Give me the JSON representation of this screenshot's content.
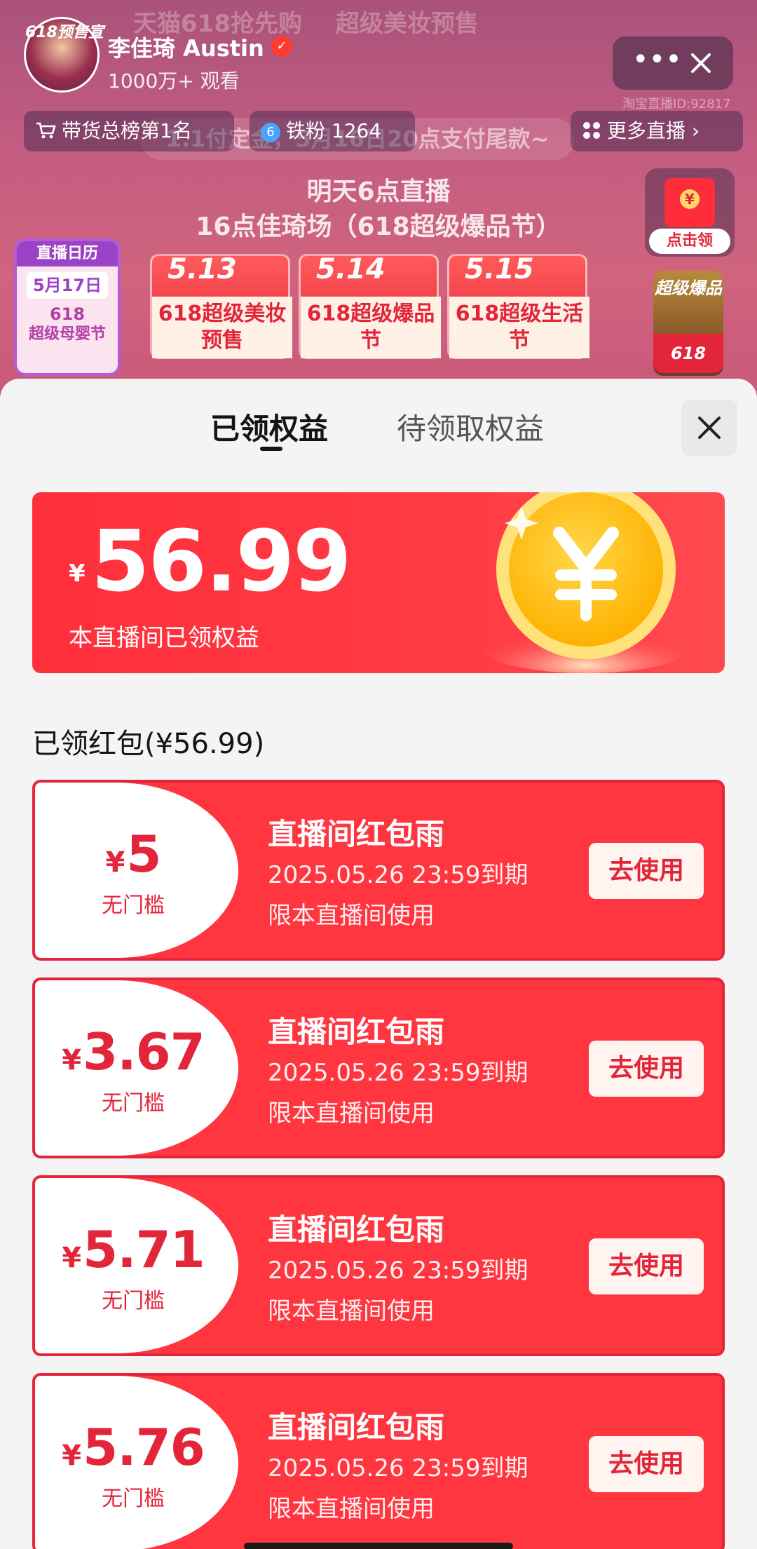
{
  "live": {
    "banner_items": [
      "天猫618抢先购",
      "超级美妆预售"
    ],
    "hero_text": "1.1付定金，5月16日20点支付尾款~",
    "schedule_line1": "明天6点直播",
    "schedule_line2": "16点佳琦场（618超级爆品节）",
    "date_cards": [
      {
        "date": "5.13",
        "title": "618超级美妆预售"
      },
      {
        "date": "5.14",
        "title": "618超级爆品节"
      },
      {
        "date": "5.15",
        "title": "618超级生活节"
      }
    ],
    "calendar": {
      "head": "直播日历",
      "date": "5月17日",
      "line1": "618",
      "line2": "超级母婴节"
    },
    "avatar_tag": "618预售宣",
    "streamer_name": "李佳琦 Austin",
    "viewers": "1000万+ 观看",
    "live_id": "淘宝直播ID:92817",
    "chips": {
      "rank": "带货总榜第1名",
      "fans_level": "6",
      "fans": "铁粉 1264",
      "more": "更多直播"
    },
    "redpack_button": "点击领",
    "promo_text": "超级爆品",
    "promo_618": "618"
  },
  "sheet": {
    "tabs": [
      {
        "label": "已领权益",
        "active": true
      },
      {
        "label": "待领取权益",
        "active": false
      }
    ],
    "summary": {
      "currency": "¥",
      "amount": "56.99",
      "label": "本直播间已领权益"
    },
    "list_title": "已领红包(¥56.99)",
    "coupons": [
      {
        "currency": "¥",
        "value": "5",
        "condition": "无门槛",
        "title": "直播间红包雨",
        "expiry": "2025.05.26 23:59到期",
        "scope": "限本直播间使用",
        "button": "去使用"
      },
      {
        "currency": "¥",
        "value": "3.67",
        "condition": "无门槛",
        "title": "直播间红包雨",
        "expiry": "2025.05.26 23:59到期",
        "scope": "限本直播间使用",
        "button": "去使用"
      },
      {
        "currency": "¥",
        "value": "5.71",
        "condition": "无门槛",
        "title": "直播间红包雨",
        "expiry": "2025.05.26 23:59到期",
        "scope": "限本直播间使用",
        "button": "去使用"
      },
      {
        "currency": "¥",
        "value": "5.76",
        "condition": "无门槛",
        "title": "直播间红包雨",
        "expiry": "2025.05.26 23:59到期",
        "scope": "限本直播间使用",
        "button": "去使用"
      }
    ]
  },
  "colors": {
    "accent_red": "#e3253a",
    "sheet_bg": "#f4f4f5",
    "coin_gold": "#ffc20a"
  },
  "icons": [
    "cart-icon",
    "more-icon",
    "close-icon",
    "grid-icon",
    "chevron-right-icon",
    "verified-icon",
    "coin-icon",
    "red-envelope-icon"
  ]
}
